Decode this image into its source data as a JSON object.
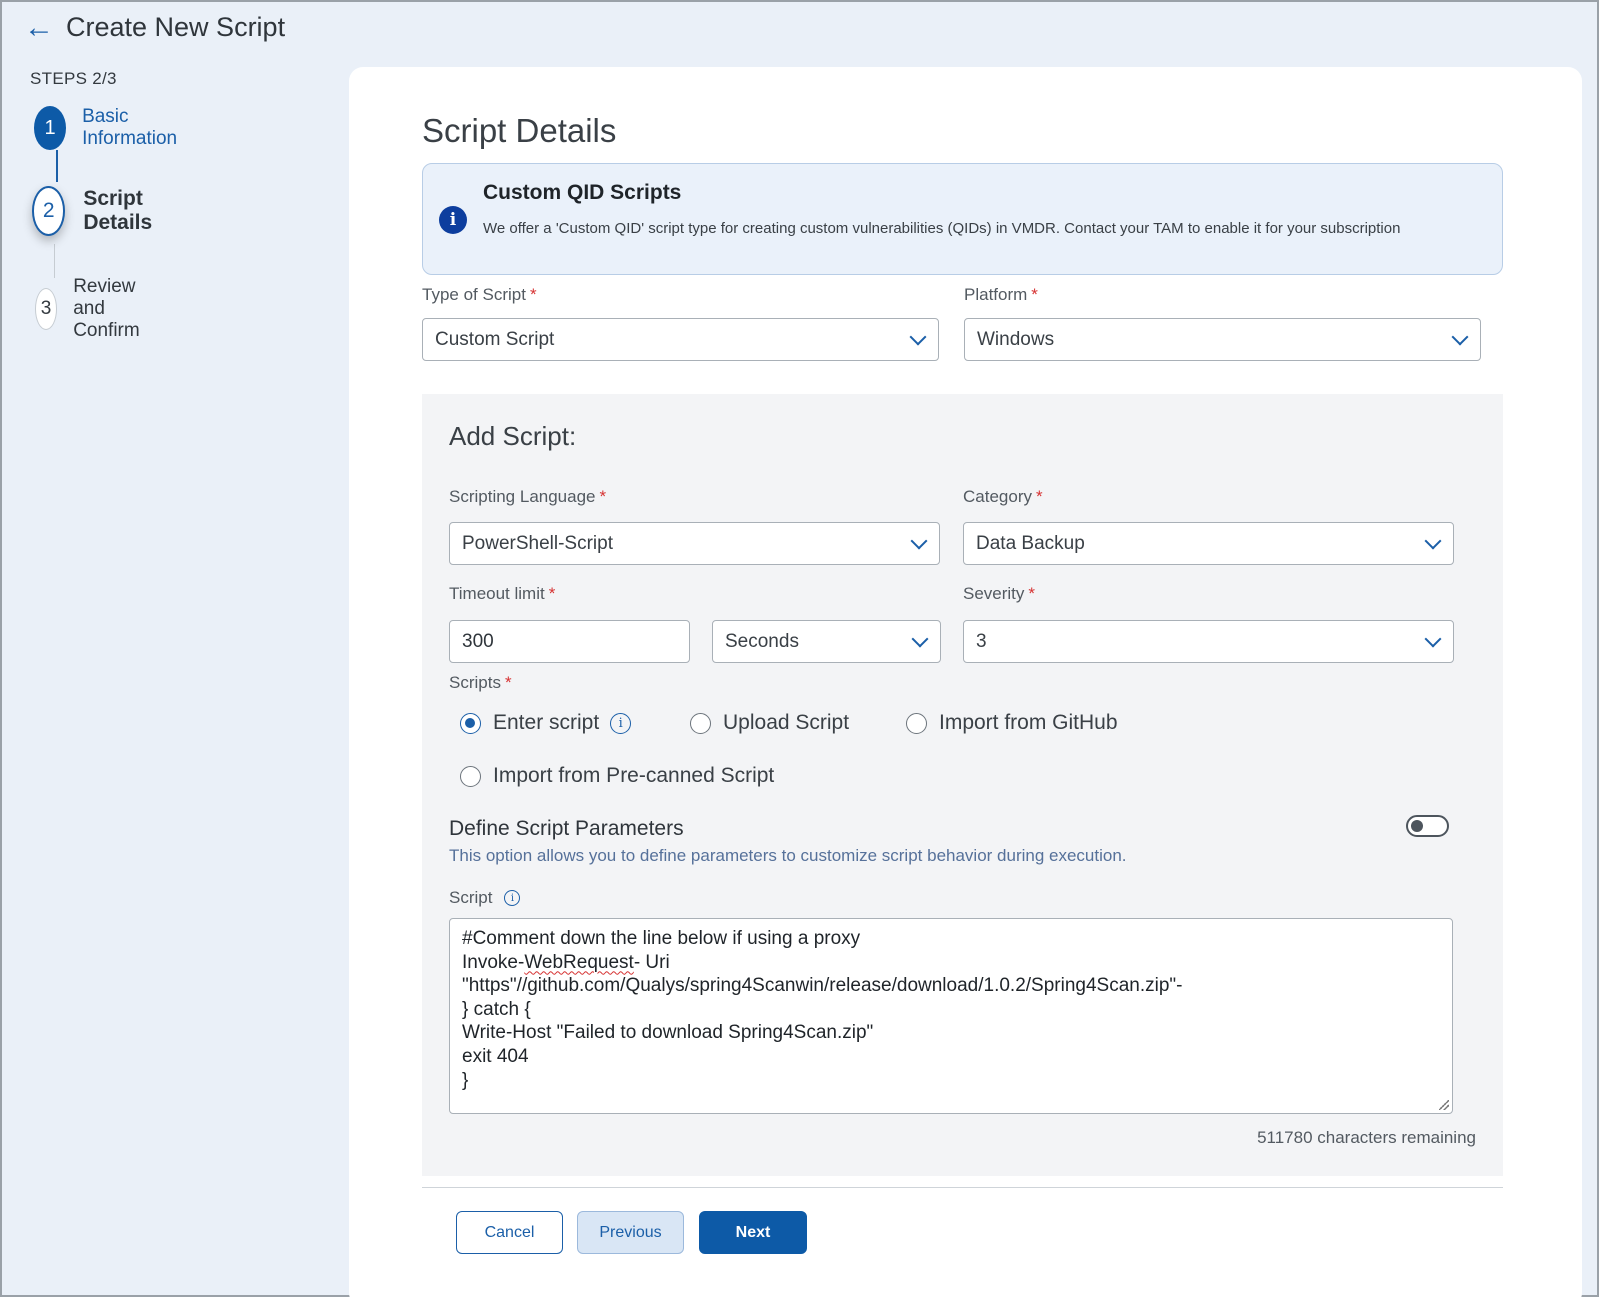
{
  "header": {
    "back_icon": "arrow-left-icon",
    "title": "Create New Script"
  },
  "steps": {
    "label": "STEPS 2/3",
    "items": [
      {
        "number": "1",
        "label": "Basic Information",
        "state": "completed"
      },
      {
        "number": "2",
        "label": "Script Details",
        "state": "active"
      },
      {
        "number": "3",
        "label": "Review and Confirm",
        "state": "pending"
      }
    ]
  },
  "main": {
    "title": "Script Details",
    "info": {
      "icon": "info-icon",
      "title": "Custom QID Scripts",
      "body": "We offer a 'Custom QID' script type for creating custom vulnerabilities (QIDs) in VMDR. Contact your TAM to enable it for your subscription"
    },
    "type_of_script": {
      "label": "Type of Script",
      "value": "Custom Script"
    },
    "platform": {
      "label": "Platform",
      "value": "Windows"
    },
    "required_mark": "*"
  },
  "add_script": {
    "title": "Add Script:",
    "scripting_language": {
      "label": "Scripting Language",
      "value": "PowerShell-Script"
    },
    "category": {
      "label": "Category",
      "value": "Data Backup"
    },
    "timeout": {
      "label": "Timeout limit",
      "value": "300",
      "unit": "Seconds"
    },
    "severity": {
      "label": "Severity",
      "value": "3"
    },
    "scripts": {
      "label": "Scripts",
      "options": [
        "Enter script",
        "Upload Script",
        "Import from GitHub",
        "Import from Pre-canned Script"
      ],
      "selected": "Enter script"
    },
    "parameters": {
      "title": "Define Script Parameters",
      "description": "This option allows you to define parameters to customize script behavior during execution.",
      "enabled": false
    },
    "script": {
      "label": "Script",
      "lines": [
        "#Comment down the line below if using a proxy",
        "Invoke-",
        "WebRequest",
        "- Uri",
        "\"https\"//github.com/Qualys/spring4Scanwin/release/download/1.0.2/Spring4Scan.zip\"-",
        "} catch {",
        "Write-Host \"Failed to download Spring4Scan.zip\"",
        "exit 404",
        "}"
      ],
      "remaining": "511780 characters remaining"
    }
  },
  "footer": {
    "cancel": "Cancel",
    "previous": "Previous",
    "next": "Next"
  },
  "colors": {
    "accent": "#0d5aa7",
    "background": "#eaf0f8",
    "required": "#d63232"
  }
}
